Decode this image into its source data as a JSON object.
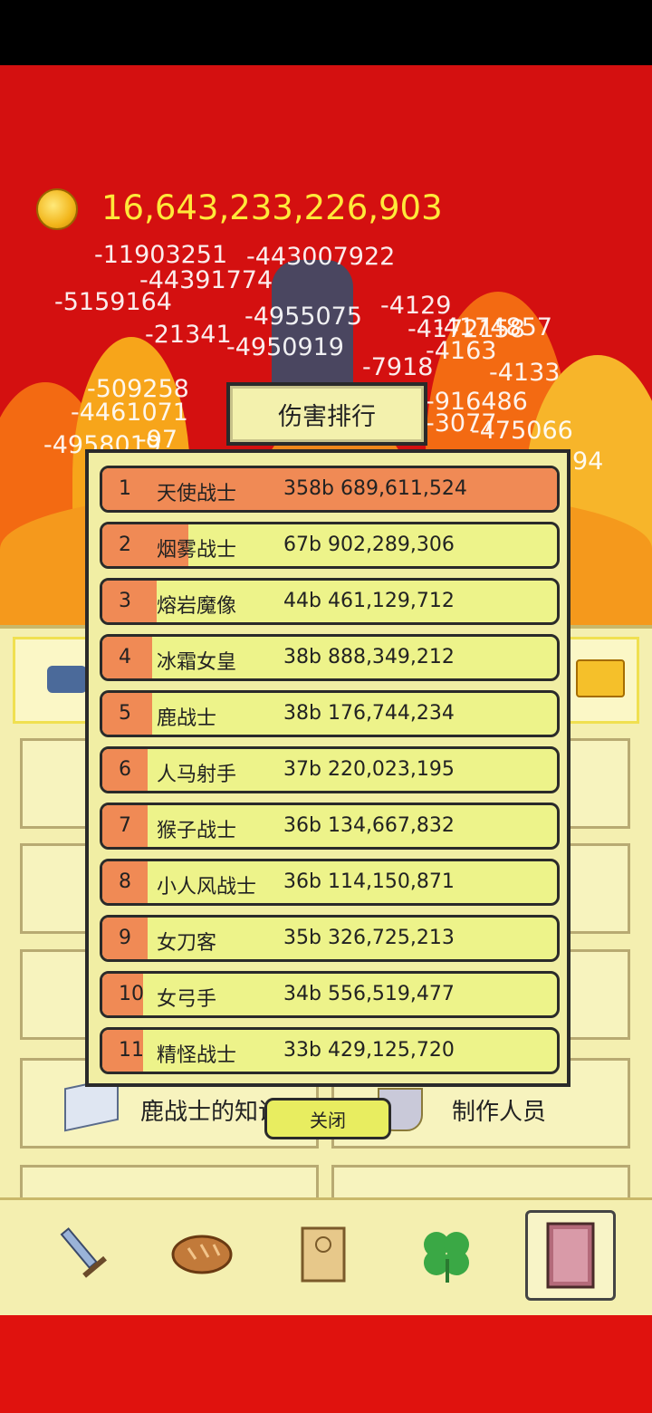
{
  "gold": "16,643,233,226,903",
  "damage_numbers": [
    "-11903251",
    "-443007922",
    "-44391774",
    "-5159164",
    "-21341",
    "-4950919",
    "-4172158",
    "-509258",
    "-4461071",
    "-4958019",
    "-916486",
    "-3077",
    "-475066",
    "-4163",
    "-4133",
    "-4129",
    "-4955075",
    "-4174857",
    "-7918",
    "-97",
    "94"
  ],
  "leaderboard": {
    "title": "伤害排行",
    "rows": [
      {
        "rank": "1",
        "name": "天使战士",
        "value": "358b 689,611,524",
        "fill": 1.0
      },
      {
        "rank": "2",
        "name": "烟雾战士",
        "value": "67b 902,289,306",
        "fill": 0.19
      },
      {
        "rank": "3",
        "name": "熔岩魔像",
        "value": "44b 461,129,712",
        "fill": 0.12
      },
      {
        "rank": "4",
        "name": "冰霜女皇",
        "value": "38b 888,349,212",
        "fill": 0.11
      },
      {
        "rank": "5",
        "name": "鹿战士",
        "value": "38b 176,744,234",
        "fill": 0.11
      },
      {
        "rank": "6",
        "name": "人马射手",
        "value": "37b 220,023,195",
        "fill": 0.1
      },
      {
        "rank": "7",
        "name": "猴子战士",
        "value": "36b 134,667,832",
        "fill": 0.1
      },
      {
        "rank": "8",
        "name": "小人风战士",
        "value": "36b 114,150,871",
        "fill": 0.1
      },
      {
        "rank": "9",
        "name": "女刀客",
        "value": "35b 326,725,213",
        "fill": 0.1
      },
      {
        "rank": "10",
        "name": "女弓手",
        "value": "34b 556,519,477",
        "fill": 0.09
      },
      {
        "rank": "11",
        "name": "精怪战士",
        "value": "33b 429,125,720",
        "fill": 0.09
      }
    ],
    "close_label": "关闭"
  },
  "menu": {
    "knowledge_label": "鹿战士的知识",
    "credits_label": "制作人员"
  },
  "nav": {
    "items": [
      "sword-icon",
      "bread-icon",
      "scroll-icon",
      "clover-icon",
      "book-icon"
    ]
  }
}
